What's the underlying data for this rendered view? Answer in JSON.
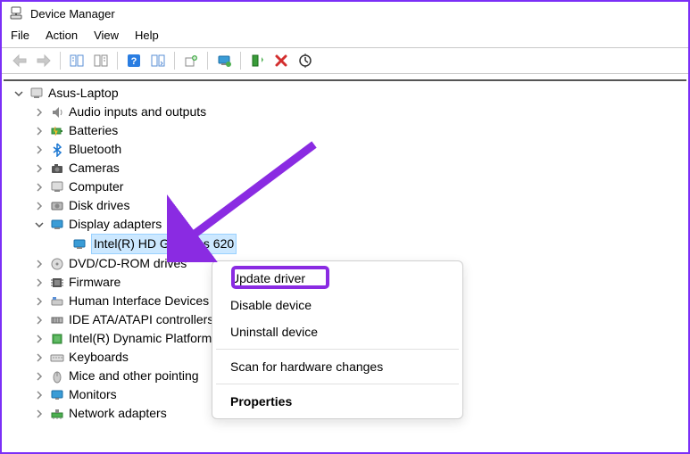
{
  "window": {
    "title": "Device Manager"
  },
  "menu": {
    "file": "File",
    "action": "Action",
    "view": "View",
    "help": "Help"
  },
  "tree": {
    "root": "Asus-Laptop",
    "items": [
      {
        "label": "Audio inputs and outputs"
      },
      {
        "label": "Batteries"
      },
      {
        "label": "Bluetooth"
      },
      {
        "label": "Cameras"
      },
      {
        "label": "Computer"
      },
      {
        "label": "Disk drives"
      },
      {
        "label": "Display adapters",
        "expanded": true,
        "children": [
          {
            "label": "Intel(R) HD Graphics 620",
            "selected": true
          }
        ]
      },
      {
        "label": "DVD/CD-ROM drives"
      },
      {
        "label": "Firmware"
      },
      {
        "label": "Human Interface Devices"
      },
      {
        "label": "IDE ATA/ATAPI controllers"
      },
      {
        "label": "Intel(R) Dynamic Platform"
      },
      {
        "label": "Keyboards"
      },
      {
        "label": "Mice and other pointing"
      },
      {
        "label": "Monitors"
      },
      {
        "label": "Network adapters"
      }
    ]
  },
  "context_menu": {
    "update": "Update driver",
    "disable": "Disable device",
    "uninstall": "Uninstall device",
    "scan": "Scan for hardware changes",
    "properties": "Properties"
  }
}
